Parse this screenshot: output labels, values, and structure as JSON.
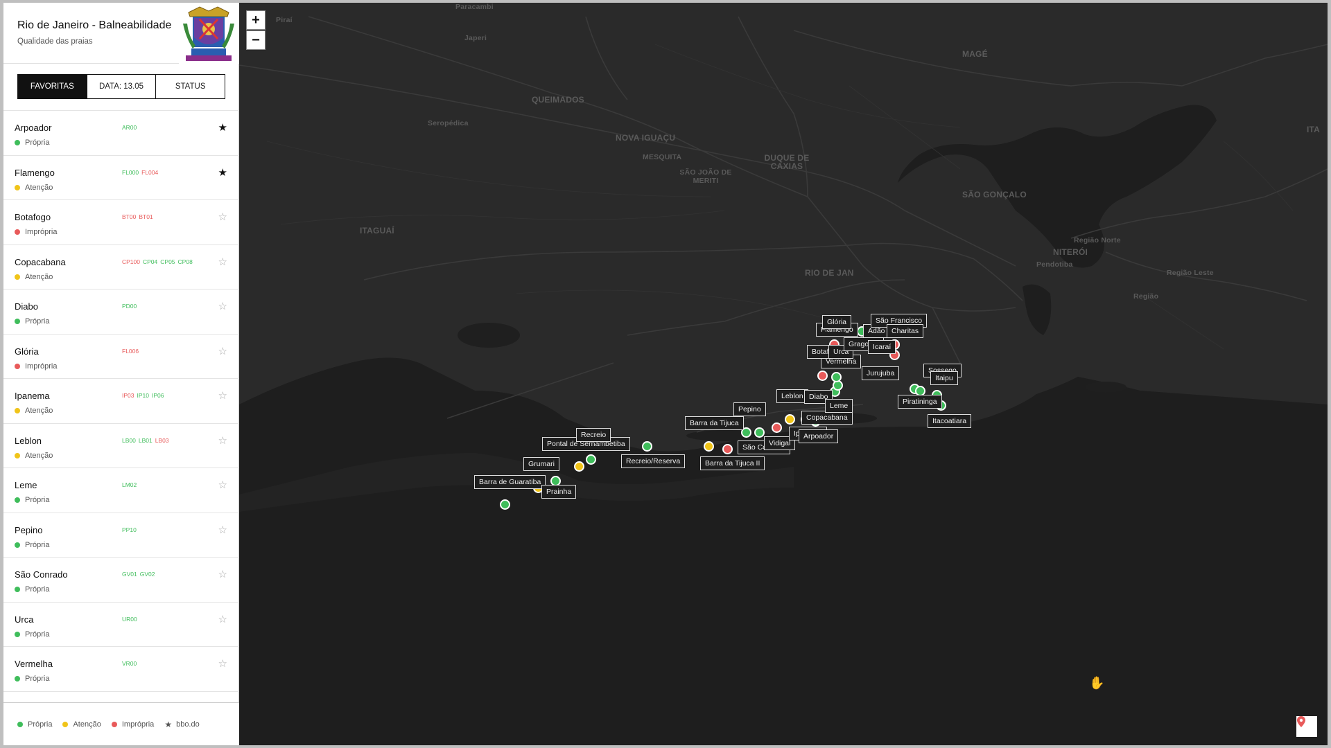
{
  "app": {
    "title": "Rio de Janeiro - Balneabilidade",
    "subtitle": "Qualidade das praias"
  },
  "tabs": [
    {
      "label": "FAVORITAS",
      "active": true
    },
    {
      "label": "DATA: 13.05",
      "active": false
    },
    {
      "label": "STATUS",
      "active": false
    }
  ],
  "beaches": [
    {
      "name": "Arpoador",
      "status": "Própria",
      "color": "green",
      "codes": [
        {
          "code": "AR00",
          "c": "g"
        }
      ],
      "favorite": true
    },
    {
      "name": "Flamengo",
      "status": "Atenção",
      "color": "yellow",
      "codes": [
        {
          "code": "FL000",
          "c": "g"
        },
        {
          "code": "FL004",
          "c": "r"
        }
      ],
      "favorite": true
    },
    {
      "name": "Botafogo",
      "status": "Imprópria",
      "color": "red",
      "codes": [
        {
          "code": "BT00",
          "c": "r"
        },
        {
          "code": "BT01",
          "c": "r"
        }
      ],
      "favorite": false
    },
    {
      "name": "Copacabana",
      "status": "Atenção",
      "color": "yellow",
      "codes": [
        {
          "code": "CP100",
          "c": "r"
        },
        {
          "code": "CP04",
          "c": "g"
        },
        {
          "code": "CP05",
          "c": "g"
        },
        {
          "code": "CP08",
          "c": "g"
        }
      ],
      "favorite": false
    },
    {
      "name": "Diabo",
      "status": "Própria",
      "color": "green",
      "codes": [
        {
          "code": "PD00",
          "c": "g"
        }
      ],
      "favorite": false
    },
    {
      "name": "Glória",
      "status": "Imprópria",
      "color": "red",
      "codes": [
        {
          "code": "FL006",
          "c": "r"
        }
      ],
      "favorite": false
    },
    {
      "name": "Ipanema",
      "status": "Atenção",
      "color": "yellow",
      "codes": [
        {
          "code": "IP03",
          "c": "r"
        },
        {
          "code": "IP10",
          "c": "g"
        },
        {
          "code": "IP06",
          "c": "g"
        }
      ],
      "favorite": false
    },
    {
      "name": "Leblon",
      "status": "Atenção",
      "color": "yellow",
      "codes": [
        {
          "code": "LB00",
          "c": "g"
        },
        {
          "code": "LB01",
          "c": "g"
        },
        {
          "code": "LB03",
          "c": "r"
        }
      ],
      "favorite": false
    },
    {
      "name": "Leme",
      "status": "Própria",
      "color": "green",
      "codes": [
        {
          "code": "LM02",
          "c": "g"
        }
      ],
      "favorite": false
    },
    {
      "name": "Pepino",
      "status": "Própria",
      "color": "green",
      "codes": [
        {
          "code": "PP10",
          "c": "g"
        }
      ],
      "favorite": false
    },
    {
      "name": "São Conrado",
      "status": "Própria",
      "color": "green",
      "codes": [
        {
          "code": "GV01",
          "c": "g"
        },
        {
          "code": "GV02",
          "c": "g"
        }
      ],
      "favorite": false
    },
    {
      "name": "Urca",
      "status": "Própria",
      "color": "green",
      "codes": [
        {
          "code": "UR00",
          "c": "g"
        }
      ],
      "favorite": false
    },
    {
      "name": "Vermelha",
      "status": "Própria",
      "color": "green",
      "codes": [
        {
          "code": "VR00",
          "c": "g"
        }
      ],
      "favorite": false
    },
    {
      "name": "Vidigal",
      "status": "",
      "color": "green",
      "codes": [],
      "favorite": false
    }
  ],
  "legend": {
    "propria": "Própria",
    "atencao": "Atenção",
    "impropria": "Imprópria",
    "favorite": "bbo.do"
  },
  "map": {
    "zoom_in": "+",
    "zoom_out": "−",
    "places": [
      {
        "name": "Paracambi",
        "cls": "small"
      },
      {
        "name": "Piraí",
        "cls": "small"
      },
      {
        "name": "Japeri",
        "cls": "small"
      },
      {
        "name": "MAGÉ",
        "cls": ""
      },
      {
        "name": "QUEIMADOS",
        "cls": ""
      },
      {
        "name": "Seropédica",
        "cls": "small"
      },
      {
        "name": "NOVA IGUAÇU",
        "cls": ""
      },
      {
        "name": "MESQUITA",
        "cls": "small"
      },
      {
        "name": "DUQUE DE CAXIAS",
        "cls": ""
      },
      {
        "name": "SÃO JOÃO DE MERITI",
        "cls": "small"
      },
      {
        "name": "SÃO GONÇALO",
        "cls": ""
      },
      {
        "name": "ITAGUAÍ",
        "cls": ""
      },
      {
        "name": "ITA",
        "cls": ""
      },
      {
        "name": "Região Norte",
        "cls": "small"
      },
      {
        "name": "NITERÓI",
        "cls": ""
      },
      {
        "name": "RIO DE JAN",
        "cls": ""
      },
      {
        "name": "Pendotiba",
        "cls": "small"
      },
      {
        "name": "Região Leste",
        "cls": "small"
      },
      {
        "name": "Região",
        "cls": "small"
      }
    ],
    "markers": [
      {
        "color": "green"
      },
      {
        "color": "yellow"
      },
      {
        "color": "green"
      },
      {
        "color": "green"
      },
      {
        "color": "yellow"
      },
      {
        "color": "green"
      },
      {
        "color": "yellow"
      },
      {
        "color": "red"
      },
      {
        "color": "green"
      },
      {
        "color": "green"
      },
      {
        "color": "red"
      },
      {
        "color": "yellow"
      },
      {
        "color": "yellow"
      },
      {
        "color": "green"
      },
      {
        "color": "red"
      },
      {
        "color": "green"
      },
      {
        "color": "green"
      },
      {
        "color": "green"
      },
      {
        "color": "red"
      },
      {
        "color": "green"
      },
      {
        "color": "green"
      },
      {
        "color": "green"
      },
      {
        "color": "red"
      },
      {
        "color": "red"
      },
      {
        "color": "green"
      },
      {
        "color": "green"
      },
      {
        "color": "green"
      },
      {
        "color": "green"
      }
    ],
    "labels": [
      {
        "text": "Barra de Guaratiba"
      },
      {
        "text": "Prainha"
      },
      {
        "text": "Grumari"
      },
      {
        "text": "Pontal de Sernambetiba"
      },
      {
        "text": "Recreio"
      },
      {
        "text": "Recreio/Reserva"
      },
      {
        "text": "Barra da Tijuca"
      },
      {
        "text": "Barra da Tijuca II"
      },
      {
        "text": "Pepino"
      },
      {
        "text": "São Conrado"
      },
      {
        "text": "Vidigal"
      },
      {
        "text": "Leblon"
      },
      {
        "text": "Ipanema"
      },
      {
        "text": "Arpoador"
      },
      {
        "text": "Copacabana"
      },
      {
        "text": "Diabo"
      },
      {
        "text": "Leme"
      },
      {
        "text": "Vermelha"
      },
      {
        "text": "Botafogo"
      },
      {
        "text": "Urca"
      },
      {
        "text": "Flamengo"
      },
      {
        "text": "Glória"
      },
      {
        "text": "Adão"
      },
      {
        "text": "Gragoatá"
      },
      {
        "text": "Icaraí"
      },
      {
        "text": "São Francisco"
      },
      {
        "text": "Charitas"
      },
      {
        "text": "Jurujuba"
      },
      {
        "text": "Sossego"
      },
      {
        "text": "Itaipu"
      },
      {
        "text": "Piratininga"
      },
      {
        "text": "Itacoatiara"
      }
    ]
  }
}
